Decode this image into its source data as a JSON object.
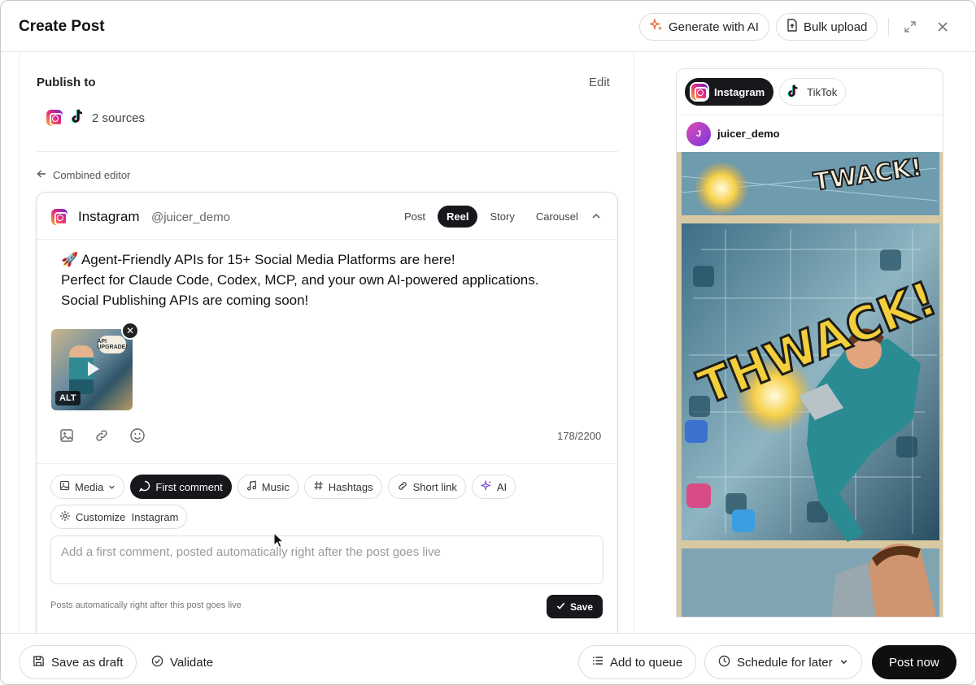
{
  "header": {
    "title": "Create Post",
    "generate_ai_label": "Generate with AI",
    "bulk_upload_label": "Bulk upload"
  },
  "publish": {
    "title": "Publish to",
    "edit_label": "Edit",
    "sources_label": "2 sources"
  },
  "editor": {
    "back_label": "Combined editor",
    "account_name": "Instagram",
    "account_handle": "@juicer_demo",
    "post_types": [
      {
        "label": "Post",
        "active": false
      },
      {
        "label": "Reel",
        "active": true
      },
      {
        "label": "Story",
        "active": false
      },
      {
        "label": "Carousel",
        "active": false
      }
    ],
    "text_lines": [
      "🚀 Agent-Friendly APIs for 15+ Social Media Platforms are here!",
      "Perfect for Claude Code, Codex, MCP, and your own AI-powered applications.",
      "Social Publishing APIs are coming soon!"
    ],
    "media_alt_badge": "ALT",
    "media_bubble": "API UPGRADE!",
    "char_count": "178/2200",
    "chips": {
      "media": "Media",
      "first_comment": "First comment",
      "music": "Music",
      "hashtags": "Hashtags",
      "short_link": "Short link",
      "ai": "AI",
      "customize": "Customize  Instagram"
    },
    "comment_placeholder": "Add a first comment, posted automatically right after the post goes live",
    "hint": "Posts automatically right after this post goes live",
    "save_label": "Save"
  },
  "preview": {
    "tabs": [
      {
        "label": "Instagram",
        "active": true
      },
      {
        "label": "TikTok",
        "active": false
      }
    ],
    "avatar_initial": "J",
    "username": "juicer_demo",
    "art_text_1": "TWACK!",
    "art_text_2": "THWACK!"
  },
  "footer": {
    "save_draft": "Save as draft",
    "validate": "Validate",
    "add_queue": "Add to queue",
    "schedule": "Schedule for later",
    "post_now": "Post now"
  },
  "colors": {
    "dark_button": "#17171c",
    "accent_ai": "#e86b2c",
    "ai_sparkle": "#7b4bd6"
  }
}
